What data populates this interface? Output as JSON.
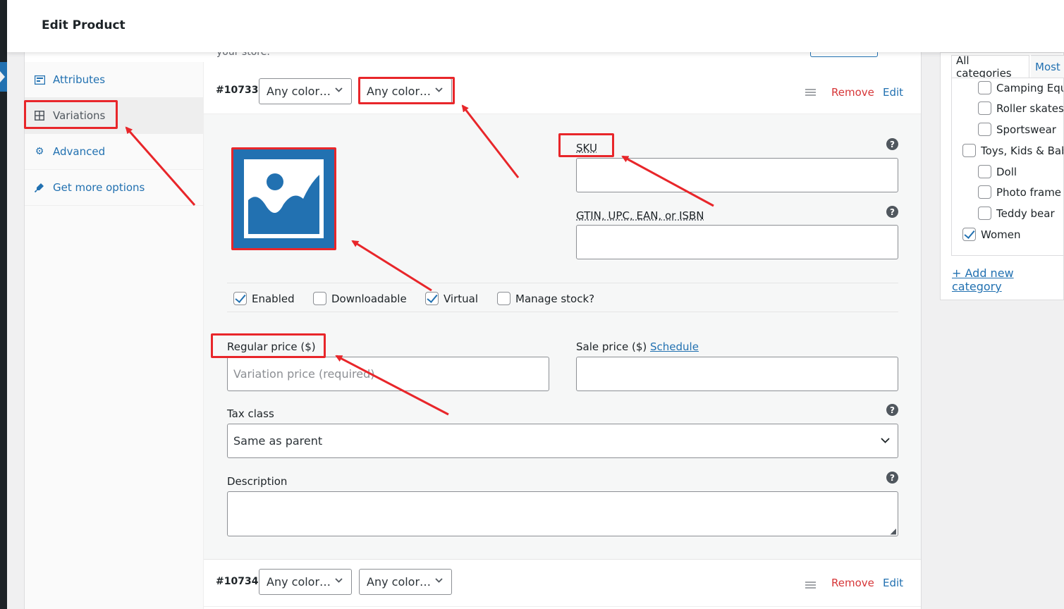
{
  "header": {
    "title": "Edit Product"
  },
  "store_hint": {
    "text": "your store."
  },
  "tabs": [
    {
      "label": "Attributes",
      "icon": "attributes-icon"
    },
    {
      "label": "Variations",
      "icon": "grid-icon"
    },
    {
      "label": "Advanced",
      "icon": "gear-icon"
    },
    {
      "label": "Get more options",
      "icon": "plugin-icon"
    }
  ],
  "variations": [
    {
      "id": "#10733",
      "select1": "Any color…",
      "select2": "Any color…",
      "remove": "Remove",
      "edit": "Edit"
    },
    {
      "id": "#10734",
      "select1": "Any color…",
      "select2": "Any color…",
      "remove": "Remove",
      "edit": "Edit"
    }
  ],
  "form": {
    "sku_label": "SKU",
    "gtin_label": "GTIN, UPC, EAN, or ISBN",
    "help_glyph": "?",
    "options": [
      {
        "label": "Enabled",
        "checked": true
      },
      {
        "label": "Downloadable",
        "checked": false
      },
      {
        "label": "Virtual",
        "checked": true
      },
      {
        "label": "Manage stock?",
        "checked": false
      }
    ],
    "regular_price_label": "Regular price ($)",
    "regular_price_placeholder": "Variation price (required)",
    "sale_price_label": "Sale price ($)",
    "schedule_link": "Schedule",
    "tax_class_label": "Tax class",
    "tax_class_value": "Same as parent",
    "description_label": "Description"
  },
  "categories": {
    "tab_all": "All categories",
    "tab_most": "Most",
    "items": [
      {
        "label": "Camping Equ",
        "checked": false,
        "indent": true
      },
      {
        "label": "Roller skates",
        "checked": false,
        "indent": true
      },
      {
        "label": "Sportswear",
        "checked": false,
        "indent": true
      },
      {
        "label": "Toys, Kids & Bab",
        "checked": false,
        "indent": false
      },
      {
        "label": "Doll",
        "checked": false,
        "indent": true
      },
      {
        "label": "Photo frame",
        "checked": false,
        "indent": true
      },
      {
        "label": "Teddy bear",
        "checked": false,
        "indent": true
      },
      {
        "label": "Women",
        "checked": true,
        "indent": false
      }
    ],
    "add_new": "+ Add new category"
  },
  "colors": {
    "accent": "#2271b1",
    "annotation": "#e8262a",
    "remove": "#d63638"
  }
}
